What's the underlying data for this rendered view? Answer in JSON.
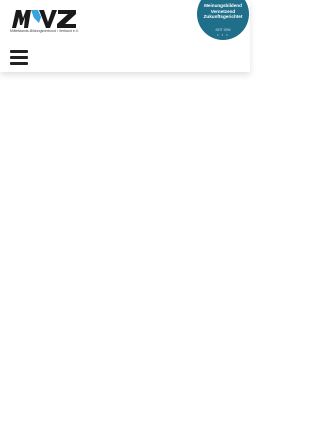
{
  "header": {
    "logo": {
      "text": "MVZ",
      "subtitle": "Mittelstands-Bildungsverbund / Verband e.V."
    },
    "badge": {
      "line1": "Meinungsbildend",
      "line2": "Vernetzend",
      "line3": "Zukunftsgerichtet",
      "since": "SEIT 1994",
      "dots": "• • •"
    },
    "menu": {
      "icon": "hamburger-menu-icon"
    }
  },
  "colors": {
    "badge_background": "#1f6f8b",
    "logo_blue": "#3aa3df",
    "text_dark": "#222222"
  }
}
